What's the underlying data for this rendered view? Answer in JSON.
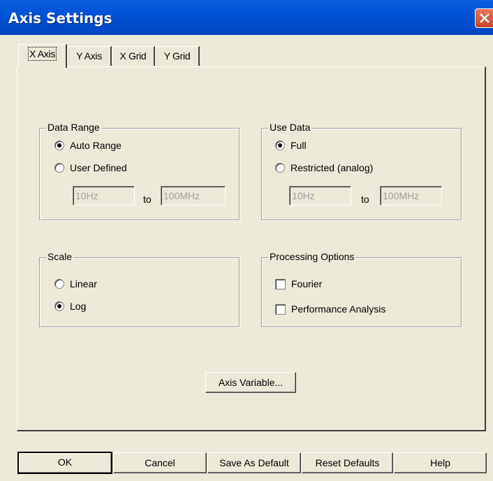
{
  "window": {
    "title": "Axis Settings"
  },
  "tabs": [
    {
      "label": "X Axis",
      "active": true
    },
    {
      "label": "Y Axis",
      "active": false
    },
    {
      "label": "X Grid",
      "active": false
    },
    {
      "label": "Y Grid",
      "active": false
    }
  ],
  "data_range": {
    "title": "Data Range",
    "options": [
      {
        "label": "Auto Range",
        "selected": true
      },
      {
        "label": "User Defined",
        "selected": false
      }
    ],
    "from_value": "10Hz",
    "to_label": "to",
    "to_value": "100MHz"
  },
  "use_data": {
    "title": "Use Data",
    "options": [
      {
        "label": "Full",
        "selected": true
      },
      {
        "label": "Restricted (analog)",
        "selected": false
      }
    ],
    "from_value": "10Hz",
    "to_label": "to",
    "to_value": "100MHz"
  },
  "scale": {
    "title": "Scale",
    "options": [
      {
        "label": "Linear",
        "selected": false
      },
      {
        "label": "Log",
        "selected": true
      }
    ]
  },
  "processing": {
    "title": "Processing Options",
    "options": [
      {
        "label": "Fourier",
        "checked": false
      },
      {
        "label": "Performance Analysis",
        "checked": false
      }
    ]
  },
  "axis_variable_label": "Axis Variable...",
  "buttons": {
    "ok": "OK",
    "cancel": "Cancel",
    "save_default": "Save As Default",
    "reset_defaults": "Reset Defaults",
    "help": "Help"
  }
}
